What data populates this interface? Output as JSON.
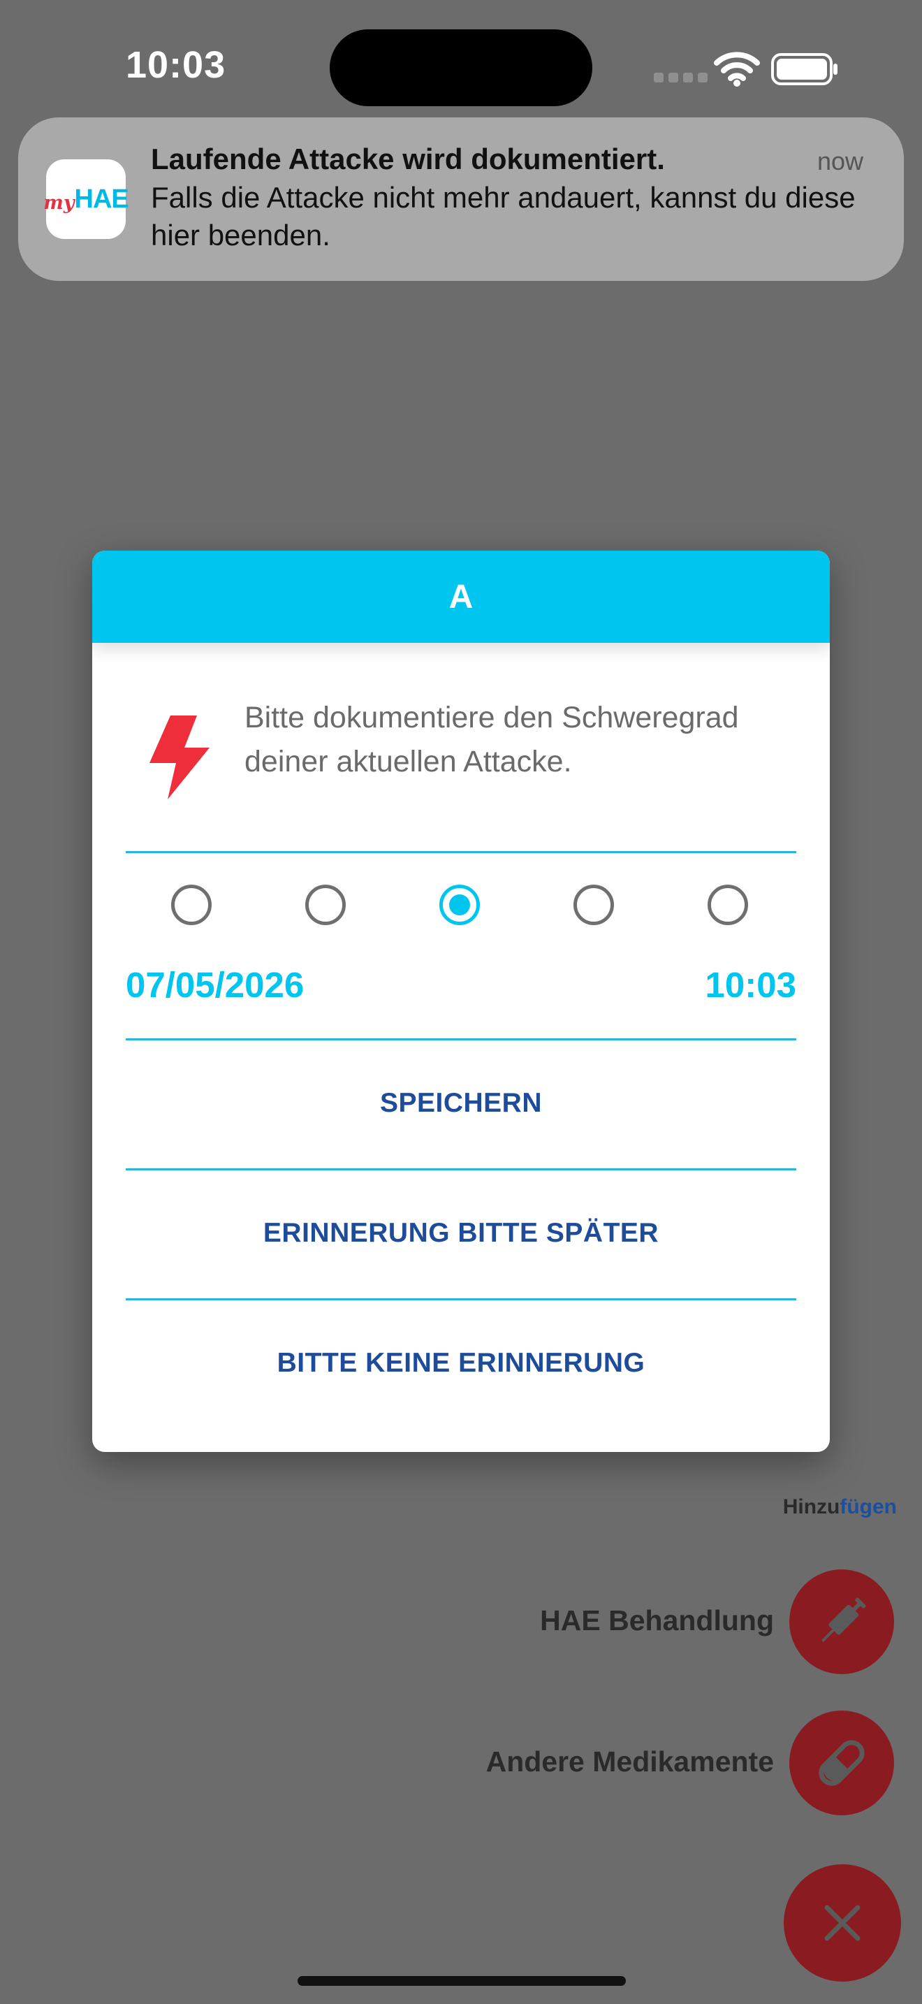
{
  "status_bar": {
    "time": "10:03"
  },
  "notification": {
    "app_icon_text": {
      "prefix": "my",
      "brand": "HAE"
    },
    "title": "Laufende Attacke wird dokumentiert.",
    "time": "now",
    "body": "Falls die Attacke nicht mehr andauert, kannst du diese hier beenden."
  },
  "dialog": {
    "header": "A",
    "icon": "lightning-bolt-icon",
    "prompt": "Bitte dokumentiere den Schweregrad deiner aktuellen Attacke.",
    "severity_selected_index": 2,
    "severity_option_count": 5,
    "date": "07/05/2026",
    "time": "10:03",
    "buttons": {
      "save": "SPEICHERN",
      "remind_later": "ERINNERUNG BITTE SPÄTER",
      "no_reminder": "BITTE KEINE ERINNERUNG"
    }
  },
  "background_menu": {
    "add_label_prefix": "Hinzu",
    "add_label_highlight": "fügen",
    "items": [
      {
        "label": "HAE Behandlung",
        "icon": "syringe-icon"
      },
      {
        "label": "Andere Medikamente",
        "icon": "pill-icon"
      }
    ],
    "close_icon": "close-icon"
  },
  "colors": {
    "accent": "#00C6EF",
    "button_text": "#1E4B9A",
    "fab": "#8A1B20",
    "bolt": "#EE2E3A",
    "overlay": "#6C6C6C"
  }
}
